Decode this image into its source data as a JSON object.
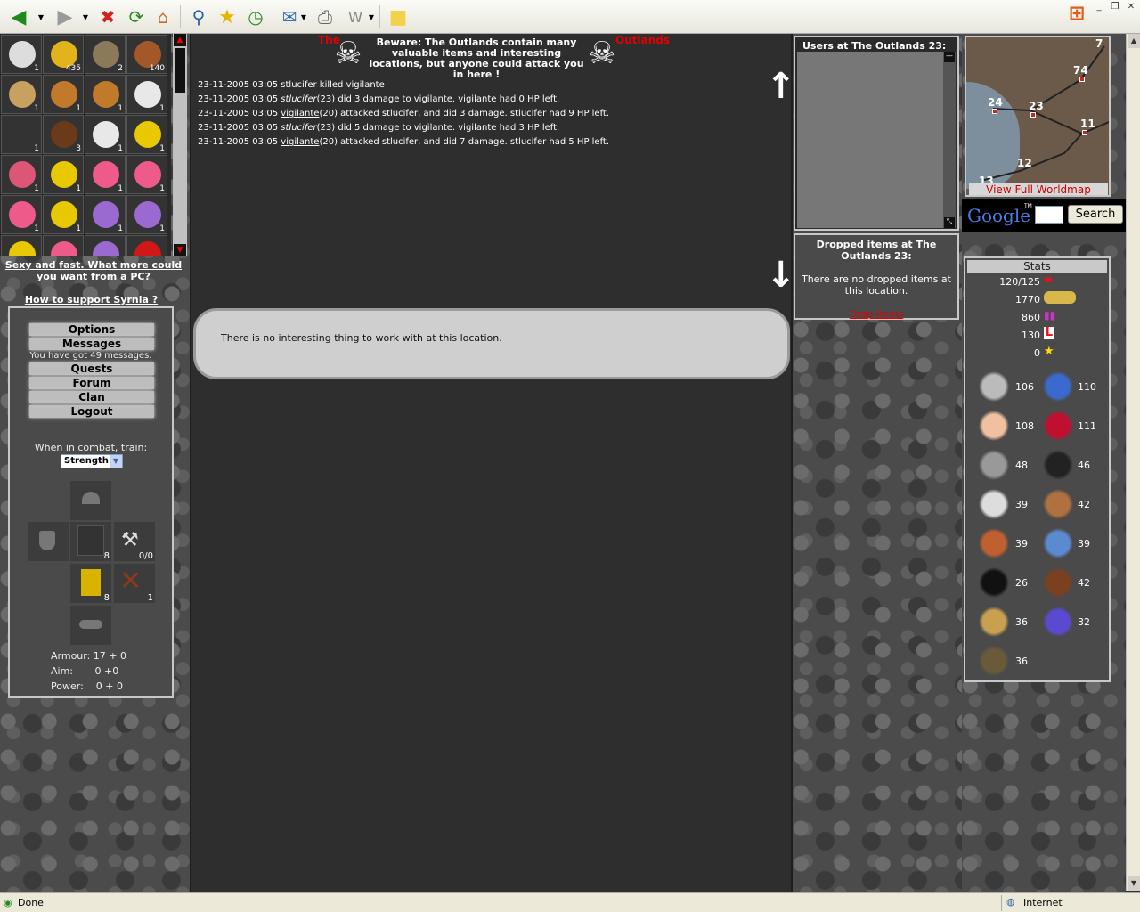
{
  "browser": {
    "status": "Done",
    "zone": "Internet"
  },
  "inventory": [
    {
      "name": "scythe",
      "qty": "1"
    },
    {
      "name": "gold",
      "qty": "435"
    },
    {
      "name": "horse",
      "qty": "2"
    },
    {
      "name": "book",
      "qty": "140"
    },
    {
      "name": "sailboat",
      "qty": "1"
    },
    {
      "name": "boat",
      "qty": "1"
    },
    {
      "name": "raft",
      "qty": "1"
    },
    {
      "name": "white-armour",
      "qty": "1"
    },
    {
      "name": "dark-armour",
      "qty": "1"
    },
    {
      "name": "leather-armour",
      "qty": "3"
    },
    {
      "name": "white-armour",
      "qty": "1"
    },
    {
      "name": "flowers-yellow",
      "qty": "1"
    },
    {
      "name": "flowers-pot",
      "qty": "1"
    },
    {
      "name": "flowers-yellow",
      "qty": "1"
    },
    {
      "name": "flowers-pink",
      "qty": "1"
    },
    {
      "name": "flowers-pink",
      "qty": "1"
    },
    {
      "name": "flowers-pink",
      "qty": "1"
    },
    {
      "name": "flowers-yellow",
      "qty": "1"
    },
    {
      "name": "flowers-purple",
      "qty": "1"
    },
    {
      "name": "flowers-purple",
      "qty": "1"
    },
    {
      "name": "flowers-yellow",
      "qty": ""
    },
    {
      "name": "flowers-pink",
      "qty": ""
    },
    {
      "name": "flowers-purple",
      "qty": ""
    },
    {
      "name": "flowers-red",
      "qty": ""
    }
  ],
  "ad_text": "Sexy and fast. What more could you want from a PC?",
  "support_link": "How to support Syrnia ?",
  "menu": {
    "options": "Options",
    "messages": "Messages",
    "messages_note": "You have got 49 messages.",
    "quests": "Quests",
    "forum": "Forum",
    "clan": "Clan",
    "logout": "Logout"
  },
  "combat": {
    "label": "When in combat, train:",
    "selected": "Strength"
  },
  "equipment": {
    "body_qty": "8",
    "hammer_qty": "0/0",
    "legs_qty": "8",
    "gloves_qty": "1",
    "armour": "Armour: 17 + 0",
    "aim": "Aim:       0 +0",
    "power": "Power:    0 + 0"
  },
  "location": {
    "the": "The",
    "outlands": "Outlands",
    "warning": "Beware: The Outlands contain many valuable items and interesting locations, but anyone could attack you in here !"
  },
  "log": [
    {
      "date": "23-11-2005 03:05",
      "who": "",
      "text": "stlucifer killed vigilante"
    },
    {
      "date": "23-11-2005 03:05",
      "who": "stlucifer",
      "style": "i",
      "text": "(23) did 3 damage to vigilante. vigilante had 0 HP left."
    },
    {
      "date": "23-11-2005 03:05",
      "who": "vigilante",
      "style": "u",
      "text": "(20) attacked stlucifer, and did 3 damage. stlucifer had 9 HP left."
    },
    {
      "date": "23-11-2005 03:05",
      "who": "stlucifer",
      "style": "i",
      "text": "(23) did 5 damage to vigilante. vigilante had 3 HP left."
    },
    {
      "date": "23-11-2005 03:05",
      "who": "vigilante",
      "style": "u",
      "text": "(20) attacked stlucifer, and did 7 damage. stlucifer had 5 HP left."
    }
  ],
  "work_message": "There is no interesting thing to work with at this location.",
  "users": {
    "title": "Users at The Outlands 23:"
  },
  "dropped": {
    "title": "Dropped items at The Outlands 23:",
    "message": "There are no dropped items at this location.",
    "link": "Drop items"
  },
  "map": {
    "numbers": [
      "7",
      "74",
      "24",
      "23",
      "11",
      "12",
      "13"
    ],
    "link": "View Full Worldmap"
  },
  "google": {
    "logo": "Google",
    "tm": "TM",
    "button": "Search"
  },
  "stats": {
    "title": "Stats",
    "hp": "120/125",
    "gold": "1770",
    "score": "860",
    "level": "130",
    "stars": "0",
    "skills": [
      {
        "icon": "sword-icon",
        "value": "106"
      },
      {
        "icon": "shield-icon",
        "value": "110"
      },
      {
        "icon": "fist-icon",
        "value": "108"
      },
      {
        "icon": "heart-icon",
        "value": "111"
      },
      {
        "icon": "pickaxe-icon",
        "value": "48"
      },
      {
        "icon": "anvil-icon",
        "value": "46"
      },
      {
        "icon": "fishing-rod-icon",
        "value": "39"
      },
      {
        "icon": "cooking-icon",
        "value": "42"
      },
      {
        "icon": "hammer-icon",
        "value": "39"
      },
      {
        "icon": "refresh-icon",
        "value": "39"
      },
      {
        "icon": "mask-icon",
        "value": "26"
      },
      {
        "icon": "boots-icon",
        "value": "42"
      },
      {
        "icon": "rope-icon",
        "value": "36"
      },
      {
        "icon": "magic-icon",
        "value": "32"
      },
      {
        "icon": "bag-icon",
        "value": "36"
      }
    ]
  },
  "colors": {
    "accent_red": "#e40000",
    "panel": "#4a4a4a",
    "center_bg": "#2e2e2e"
  }
}
